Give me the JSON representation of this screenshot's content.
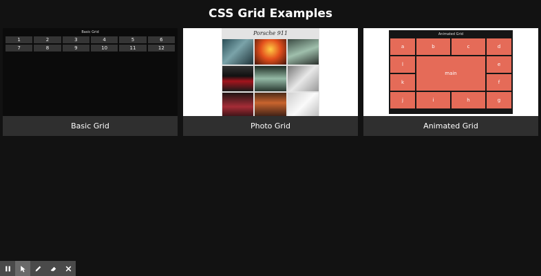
{
  "page": {
    "title": "CSS Grid Examples"
  },
  "cards": {
    "basic": {
      "label": "Basic Grid",
      "preview_title": "Basic Grid",
      "cells": [
        "1",
        "2",
        "3",
        "4",
        "5",
        "6",
        "7",
        "8",
        "9",
        "10",
        "11",
        "12"
      ]
    },
    "photo": {
      "label": "Photo Grid",
      "preview_title": "Porsche 911"
    },
    "animated": {
      "label": "Animated Grid",
      "preview_title": "Animated Grid",
      "cells": {
        "a": "a",
        "b": "b",
        "c": "c",
        "d": "d",
        "l": "l",
        "main": "main",
        "e": "e",
        "k": "k",
        "f": "f",
        "j": "j",
        "i": "i",
        "h": "h",
        "g": "g"
      }
    }
  },
  "toolbar": {
    "icons": [
      "pause-icon",
      "pointer-icon",
      "pen-icon",
      "eraser-icon",
      "close-icon"
    ]
  }
}
